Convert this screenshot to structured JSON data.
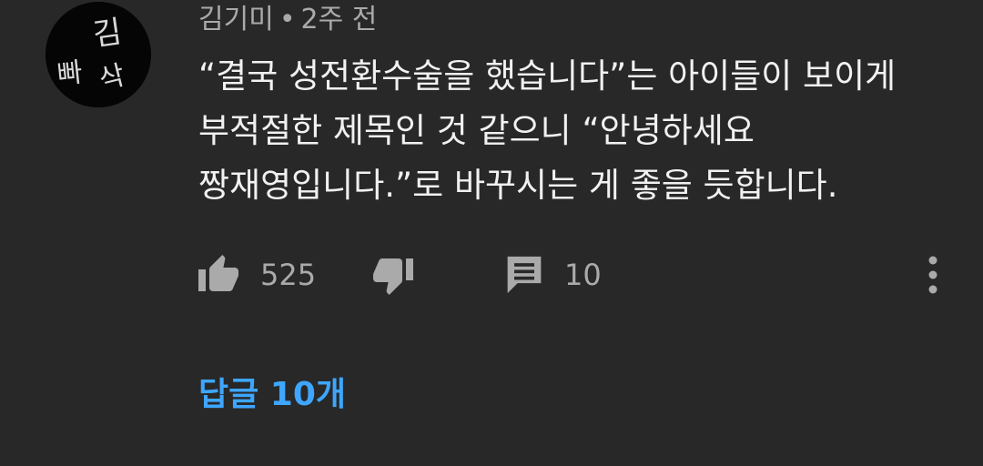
{
  "comment": {
    "author": "김기미",
    "separator": "•",
    "time": "2주 전",
    "avatar_text": [
      "김",
      "빠",
      "삭"
    ],
    "body_lines": [
      "“결국 성전환수술을 했습니다”는 아이들이 보이게",
      "부적절한 제목인 것 같으니 “안녕하세요",
      "짱재영입니다.”로 바꾸시는 게 좋을 듯합니다."
    ],
    "likes": "525",
    "reply_count": "10",
    "replies_link": "답글 10개"
  },
  "icons": {
    "like": "thumbs-up-icon",
    "dislike": "thumbs-down-icon",
    "reply": "comment-icon",
    "more": "vertical-ellipsis-icon"
  },
  "colors": {
    "background": "#282828",
    "text": "#f1f1f1",
    "secondary": "#aaaaaa",
    "link": "#3ea6ff"
  }
}
